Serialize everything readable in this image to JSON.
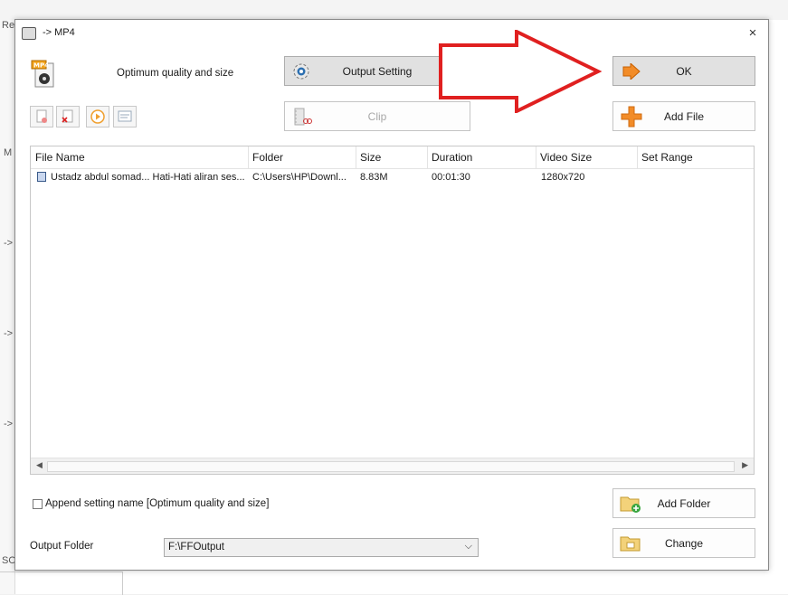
{
  "background": {
    "left_labels": [
      "Re",
      "M",
      "->",
      "->",
      "->",
      "SO"
    ]
  },
  "dialog": {
    "title": "-> MP4",
    "close_label": "×",
    "profile_text": "Optimum quality and size",
    "buttons": {
      "output_setting": "Output Setting",
      "ok": "OK",
      "clip": "Clip",
      "add_file": "Add File",
      "add_folder": "Add Folder",
      "change": "Change"
    },
    "list": {
      "columns": [
        "File Name",
        "Folder",
        "Size",
        "Duration",
        "Video Size",
        "Set Range"
      ],
      "rows": [
        {
          "file_name": "Ustadz abdul somad... Hati-Hati aliran ses...",
          "folder": "C:\\Users\\HP\\Downl...",
          "size": "8.83M",
          "duration": "00:01:30",
          "video_size": "1280x720",
          "set_range": ""
        }
      ]
    },
    "append_setting_label": "Append setting name [Optimum quality and size]",
    "append_checked": false,
    "output_folder_label": "Output Folder",
    "output_folder_value": "F:\\FFOutput"
  },
  "colors": {
    "accent_orange": "#f28c28",
    "arrow_red": "#e02020"
  }
}
